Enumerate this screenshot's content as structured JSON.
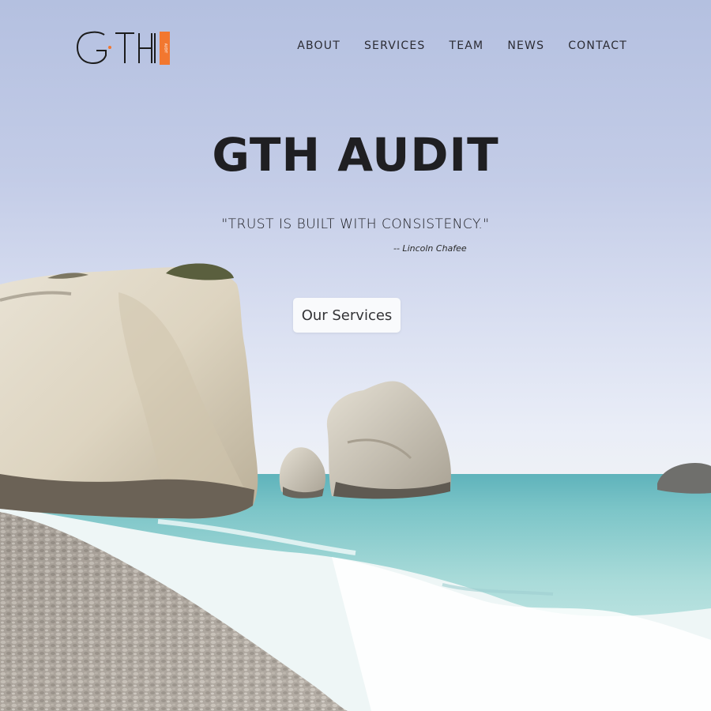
{
  "brand": {
    "logo_letters": "GTH",
    "logo_tagline": "AUDIT",
    "accent_color": "#f2772f"
  },
  "nav": {
    "items": [
      {
        "label": "ABOUT"
      },
      {
        "label": "SERVICES"
      },
      {
        "label": "TEAM"
      },
      {
        "label": "NEWS"
      },
      {
        "label": "CONTACT"
      }
    ]
  },
  "hero": {
    "title": "GTH AUDIT",
    "quote": "\"TRUST IS BUILT WITH CONSISTENCY.\"",
    "quote_author": "-- Lincoln Chafee",
    "cta_label": "Our Services",
    "background_image": "coastal-rocks-photo"
  }
}
